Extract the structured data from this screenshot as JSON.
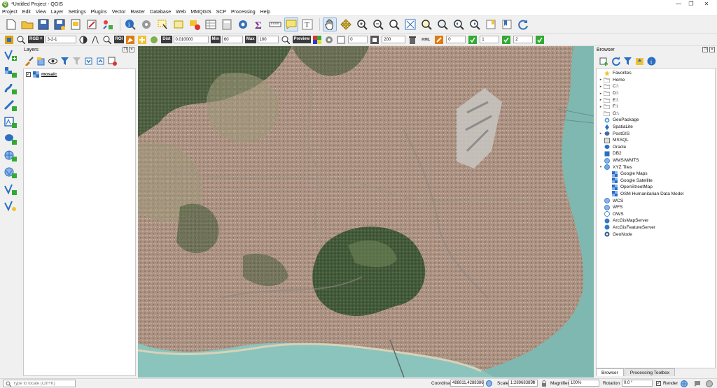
{
  "window": {
    "title": "*Untitled Project - QGIS",
    "minimize_glyph": "—",
    "maximize_glyph": "❐",
    "close_glyph": "✕"
  },
  "menu": [
    "Project",
    "Edit",
    "View",
    "Layer",
    "Settings",
    "Plugins",
    "Vector",
    "Raster",
    "Database",
    "Web",
    "MMQGIS",
    "SCP",
    "Processing",
    "Help"
  ],
  "scp_toolbar": {
    "rgb_label": "RGB =",
    "rgb_value": "3-2-1",
    "roi_label": "ROI",
    "dist_label": "Dist",
    "dist_value": "0.010000",
    "min_label": "Min",
    "min_value": "60",
    "max_label": "Max",
    "max_value": "100",
    "preview_label": "Preview",
    "field1": "0",
    "field2": "200",
    "kml_label": "KML",
    "field3": "0",
    "field4": "1",
    "field5": "2"
  },
  "layers_panel": {
    "title": "Layers",
    "layer_name": "mosaic",
    "layer_checked": "✓"
  },
  "browser_panel": {
    "title": "Browser",
    "items": [
      {
        "label": "Favorites",
        "icon": "star-icon",
        "arrow": "",
        "indent": 0
      },
      {
        "label": "Home",
        "icon": "folder-icon",
        "arrow": "▸",
        "indent": 0
      },
      {
        "label": "C:\\",
        "icon": "folder-icon",
        "arrow": "▸",
        "indent": 0
      },
      {
        "label": "D:\\",
        "icon": "folder-icon",
        "arrow": "▸",
        "indent": 0
      },
      {
        "label": "E:\\",
        "icon": "folder-icon",
        "arrow": "▸",
        "indent": 0
      },
      {
        "label": "F:\\",
        "icon": "folder-icon",
        "arrow": "▸",
        "indent": 0
      },
      {
        "label": "G:\\",
        "icon": "folder-icon",
        "arrow": "",
        "indent": 0
      },
      {
        "label": "GeoPackage",
        "icon": "geopackage-icon",
        "arrow": "",
        "indent": 0
      },
      {
        "label": "SpatiaLite",
        "icon": "spatialite-icon",
        "arrow": "",
        "indent": 0
      },
      {
        "label": "PostGIS",
        "icon": "postgis-icon",
        "arrow": "▸",
        "indent": 0
      },
      {
        "label": "MSSQL",
        "icon": "mssql-icon",
        "arrow": "",
        "indent": 0
      },
      {
        "label": "Oracle",
        "icon": "oracle-icon",
        "arrow": "",
        "indent": 0
      },
      {
        "label": "DB2",
        "icon": "db2-icon",
        "arrow": "",
        "indent": 0
      },
      {
        "label": "WMS/WMTS",
        "icon": "globe-icon",
        "arrow": "",
        "indent": 0
      },
      {
        "label": "XYZ Tiles",
        "icon": "xyz-tiles-icon",
        "arrow": "▾",
        "indent": 0
      },
      {
        "label": "Google Maps",
        "icon": "tile-layer-icon",
        "arrow": "",
        "indent": 1
      },
      {
        "label": "Google Satellite",
        "icon": "tile-layer-icon",
        "arrow": "",
        "indent": 1
      },
      {
        "label": "OpenStreetMap",
        "icon": "tile-layer-icon",
        "arrow": "",
        "indent": 1
      },
      {
        "label": "OSM Humanitarian Data Model",
        "icon": "tile-layer-icon",
        "arrow": "",
        "indent": 1
      },
      {
        "label": "WCS",
        "icon": "globe-icon",
        "arrow": "",
        "indent": 0
      },
      {
        "label": "WFS",
        "icon": "globe-icon",
        "arrow": "",
        "indent": 0
      },
      {
        "label": "OWS",
        "icon": "ows-icon",
        "arrow": "",
        "indent": 0
      },
      {
        "label": "ArcGisMapServer",
        "icon": "arcgis-icon",
        "arrow": "",
        "indent": 0
      },
      {
        "label": "ArcGisFeatureServer",
        "icon": "arcgis-icon",
        "arrow": "",
        "indent": 0
      },
      {
        "label": "GeoNode",
        "icon": "geonode-icon",
        "arrow": "",
        "indent": 0
      }
    ],
    "tabs": [
      "Browser",
      "Processing Toolbox"
    ]
  },
  "statusbar": {
    "locate_placeholder": "Type to locate (Ctrl+K)",
    "coordinate_label": "Coordinate",
    "coordinate_value": "488811,4288386",
    "scale_label": "Scale",
    "scale_value": "1:289683853",
    "magnifier_label": "Magnifier",
    "magnifier_value": "100%",
    "rotation_label": "Rotation",
    "rotation_value": "0.0 °",
    "render_label": "Render",
    "render_checked": "✓"
  },
  "colors": {
    "accent_green": "#5d9e32",
    "qgis_yellow": "#f1c232",
    "water": "#7fbfb8",
    "urban": "#b79a86",
    "forest": "#3d5a34"
  }
}
